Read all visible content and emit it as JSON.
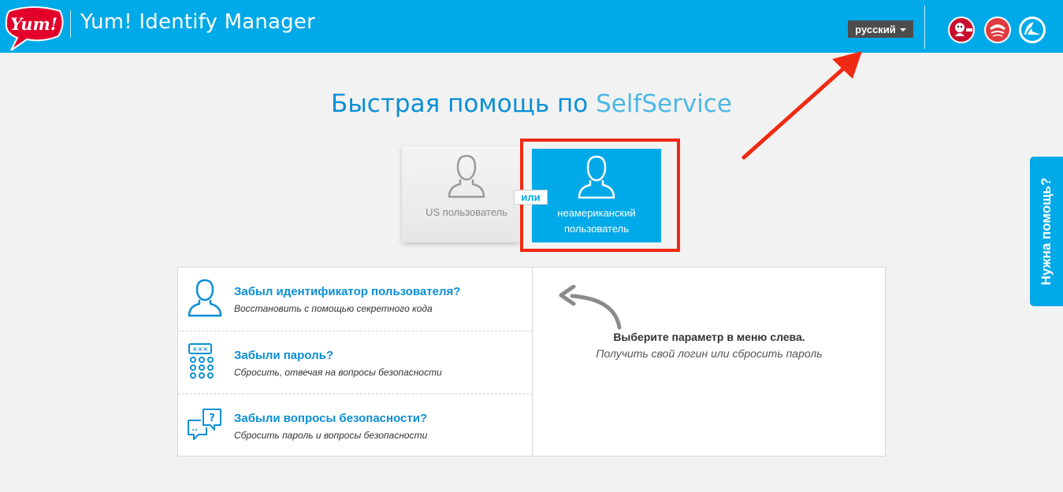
{
  "header": {
    "logo_text": "Yum!",
    "app_title": "Yum! Identify Manager",
    "language_label": "русский",
    "brands": [
      "kfc-logo",
      "pizza-hut-logo",
      "taco-bell-logo"
    ]
  },
  "main": {
    "title_main": "Быстрая помощь по",
    "title_highlight": "SelfService",
    "user_types": {
      "us_label": "US пользователь",
      "or_label": "или",
      "intl_label_line1": "неамериканский",
      "intl_label_line2": "пользователь"
    },
    "options": [
      {
        "title": "Забыл идентификатор пользователя?",
        "subtitle": "Восстановить с помощью секретного кода"
      },
      {
        "title": "Забыли пароль?",
        "subtitle": "Сбросить, отвечая на вопросы безопасности"
      },
      {
        "title": "Забыли вопросы безопасности?",
        "subtitle": "Сбросить пароль и вопросы безопасности"
      }
    ],
    "right_panel": {
      "heading": "Выберите параметр в меню слева.",
      "subtext": "Получить свой логин или сбросить пароль"
    }
  },
  "help_tab": {
    "label": "Нужна помощь?"
  },
  "colors": {
    "accent": "#00a9e8",
    "title": "#0a8fd6",
    "highlight_border": "#f02a12",
    "lang_btn": "#4d4d4d"
  }
}
